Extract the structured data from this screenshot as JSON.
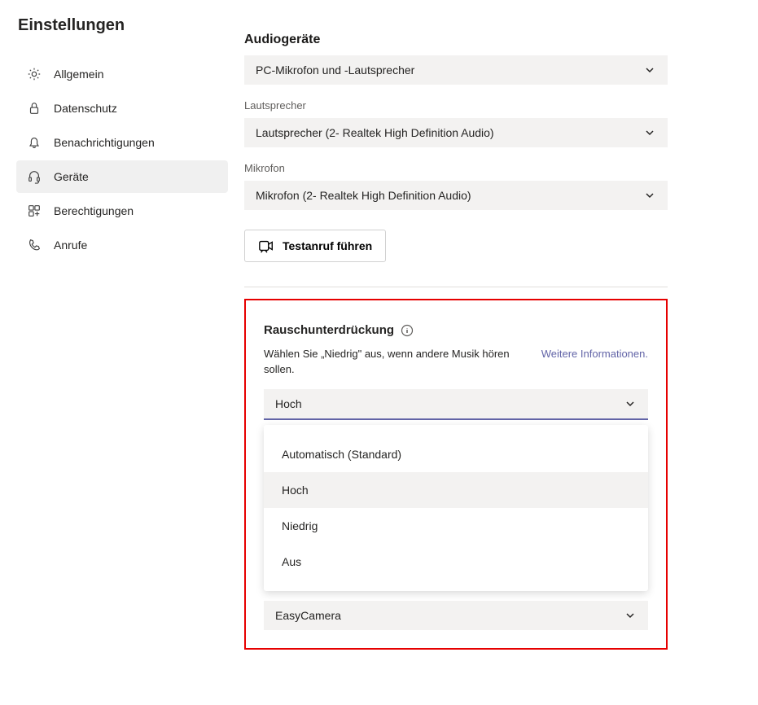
{
  "page_title": "Einstellungen",
  "sidebar": {
    "items": [
      {
        "label": "Allgemein"
      },
      {
        "label": "Datenschutz"
      },
      {
        "label": "Benachrichtigungen"
      },
      {
        "label": "Geräte"
      },
      {
        "label": "Berechtigungen"
      },
      {
        "label": "Anrufe"
      }
    ]
  },
  "audio": {
    "section_title": "Audiogeräte",
    "device_select": "PC-Mikrofon und -Lautsprecher",
    "speaker_label": "Lautsprecher",
    "speaker_select": "Lautsprecher (2- Realtek High Definition Audio)",
    "mic_label": "Mikrofon",
    "mic_select": "Mikrofon (2- Realtek High Definition Audio)"
  },
  "test_call_button": "Testanruf führen",
  "noise": {
    "title": "Rauschunterdrückung",
    "description": "Wählen Sie „Niedrig\" aus, wenn andere Musik hören sollen.",
    "link": "Weitere Informationen.",
    "selected": "Hoch",
    "options": [
      "Automatisch (Standard)",
      "Hoch",
      "Niedrig",
      "Aus"
    ]
  },
  "camera_select": "EasyCamera"
}
